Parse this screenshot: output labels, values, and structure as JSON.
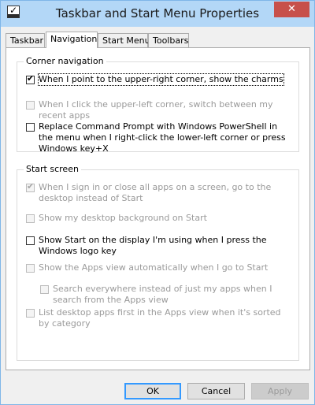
{
  "window": {
    "title": "Taskbar and Start Menu Properties",
    "close_label": "✕"
  },
  "tabs": [
    {
      "label": "Taskbar",
      "active": false
    },
    {
      "label": "Navigation",
      "active": true
    },
    {
      "label": "Start Menu",
      "active": false
    },
    {
      "label": "Toolbars",
      "active": false
    }
  ],
  "corner_navigation": {
    "title": "Corner navigation",
    "options": [
      {
        "label": "When I point to the upper-right corner, show the charms",
        "checked": true,
        "enabled": true
      },
      {
        "label": "When I click the upper-left corner, switch between my recent apps",
        "checked": false,
        "enabled": false
      },
      {
        "label": "Replace Command Prompt with Windows PowerShell in the menu when I right-click the lower-left corner or press Windows key+X",
        "checked": false,
        "enabled": true
      }
    ]
  },
  "start_screen": {
    "title": "Start screen",
    "options": [
      {
        "label": "When I sign in or close all apps on a screen, go to the desktop instead of Start",
        "checked": true,
        "enabled": false
      },
      {
        "label": "Show my desktop background on Start",
        "checked": false,
        "enabled": false
      },
      {
        "label": "Show Start on the display I'm using when I press the Windows logo key",
        "checked": false,
        "enabled": true
      },
      {
        "label": "Show the Apps view automatically when I go to Start",
        "checked": false,
        "enabled": false
      },
      {
        "label": "Search everywhere instead of just my apps when I search from the Apps view",
        "checked": false,
        "enabled": false
      },
      {
        "label": "List desktop apps first in the Apps view when it's sorted by category",
        "checked": false,
        "enabled": false
      }
    ]
  },
  "buttons": {
    "ok": "OK",
    "cancel": "Cancel",
    "apply": "Apply"
  },
  "colors": {
    "titlebar": "#b3d7f7",
    "close": "#c7504b",
    "accent": "#3399ff"
  }
}
